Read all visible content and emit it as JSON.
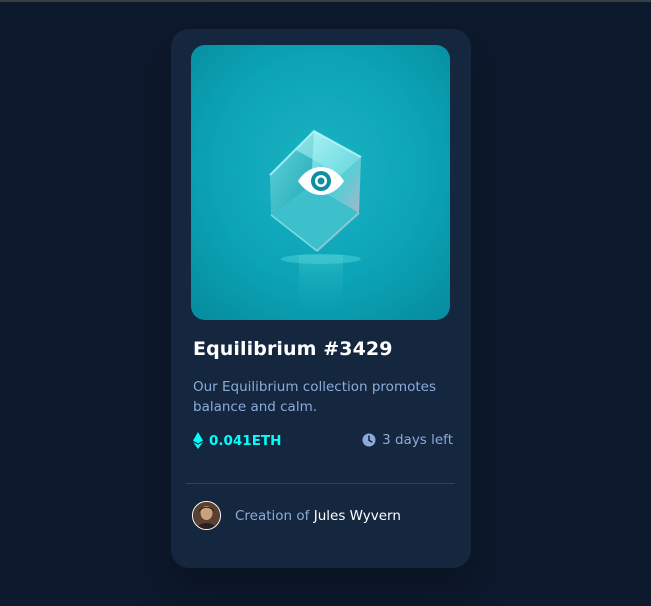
{
  "card": {
    "image_alt": "Equilibrium",
    "title": "Equilibrium #3429",
    "description": "Our Equilibrium collection promotes balance and calm.",
    "price": "0.041ETH",
    "time_left": "3 days left",
    "creator_prefix": "Creation of",
    "creator_name": "Jules Wyvern"
  },
  "colors": {
    "page_bg": "#0d192c",
    "card_bg": "#15263f",
    "accent_cyan": "#00fff8",
    "soft_blue": "#8bacd9",
    "white": "#ffffff"
  },
  "icons": {
    "view": "eye-icon",
    "price": "ethereum-icon",
    "time": "clock-icon"
  }
}
